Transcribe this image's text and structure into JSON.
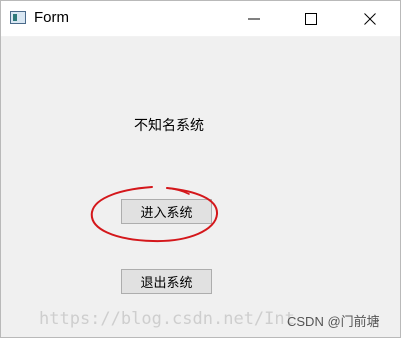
{
  "window": {
    "title": "Form",
    "icons": {
      "app": "app-window-icon",
      "minimize": "minimize-icon",
      "maximize": "maximize-icon",
      "close": "close-icon"
    }
  },
  "main": {
    "label": "不知名系统",
    "enter_button": "进入系统",
    "exit_button": "退出系统"
  },
  "annotation": {
    "color": "#d4171b",
    "shape": "hand-drawn circle around the enter button"
  },
  "watermark": {
    "url_text": "https://blog.csdn.net/Int",
    "csdn_credit": "CSDN @门前塘"
  }
}
